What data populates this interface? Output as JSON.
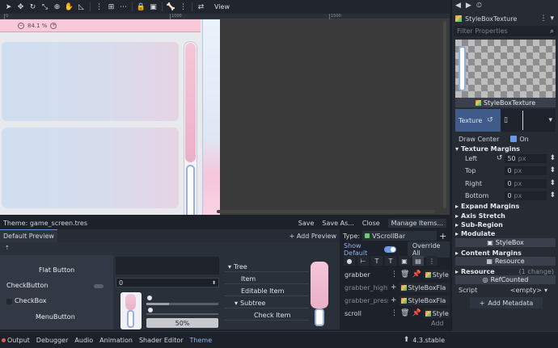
{
  "toolbar": {
    "view_label": "View"
  },
  "ruler": {
    "ticks": [
      "0",
      "1000",
      "1500"
    ]
  },
  "canvas": {
    "zoom": "84.1 %"
  },
  "theme_header": {
    "title": "Theme: game_screen.tres",
    "save": "Save",
    "save_as": "Save As...",
    "close": "Close",
    "manage_items": "Manage Items..."
  },
  "preview_tabs": {
    "default_preview": "Default Preview",
    "add_preview": "+ Add Preview",
    "type_label": "Type:",
    "type_value": "VScrollBar",
    "type_add": "+"
  },
  "preview": {
    "flat_button": "Flat Button",
    "check_button": "CheckButton",
    "check_box": "CheckBox",
    "menu_button": "MenuButton",
    "spin_value": "0",
    "progress": "50%",
    "progress_value": 0.5,
    "tree": {
      "root": "Tree",
      "item": "Item",
      "editable": "Editable Item",
      "subtree": "Subtree",
      "check": "Check Item"
    }
  },
  "type_props": {
    "show_default": "Show Default",
    "override_all": "Override All",
    "rows": [
      {
        "name": "grabber",
        "value": "Style",
        "dim": false
      },
      {
        "name": "grabber_highlight",
        "value": "StyleBoxFla",
        "dim": true
      },
      {
        "name": "grabber_pressed",
        "value": "StyleBoxFla",
        "dim": true
      },
      {
        "name": "scroll",
        "value": "Style",
        "dim": false
      }
    ],
    "add": "Add"
  },
  "statusbar": {
    "output": "Output",
    "debugger": "Debugger",
    "audio": "Audio",
    "animation": "Animation",
    "shader_editor": "Shader Editor",
    "theme": "Theme",
    "version": "4.3.stable"
  },
  "inspector": {
    "resource_type": "StyleBoxTexture",
    "filter_placeholder": "Filter Properties",
    "preview_label": "StyleBoxTexture",
    "texture_label": "Texture",
    "draw_center": "Draw Center",
    "draw_center_value": "On",
    "texture_margins": "Texture Margins",
    "margins": [
      {
        "label": "Left",
        "value": "50",
        "unit": "px"
      },
      {
        "label": "Top",
        "value": "0",
        "unit": "px"
      },
      {
        "label": "Right",
        "value": "0",
        "unit": "px"
      },
      {
        "label": "Bottom",
        "value": "0",
        "unit": "px"
      }
    ],
    "expand_margins": "Expand Margins",
    "axis_stretch": "Axis Stretch",
    "sub_region": "Sub-Region",
    "modulate": "Modulate",
    "stylebox_cat": "StyleBox",
    "content_margins": "Content Margins",
    "resource_cat": "Resource",
    "resource_section": "Resource",
    "resource_changes": "(1 change)",
    "refcounted_cat": "RefCounted",
    "script_label": "Script",
    "script_value": "<empty>",
    "add_metadata": "Add Metadata"
  }
}
